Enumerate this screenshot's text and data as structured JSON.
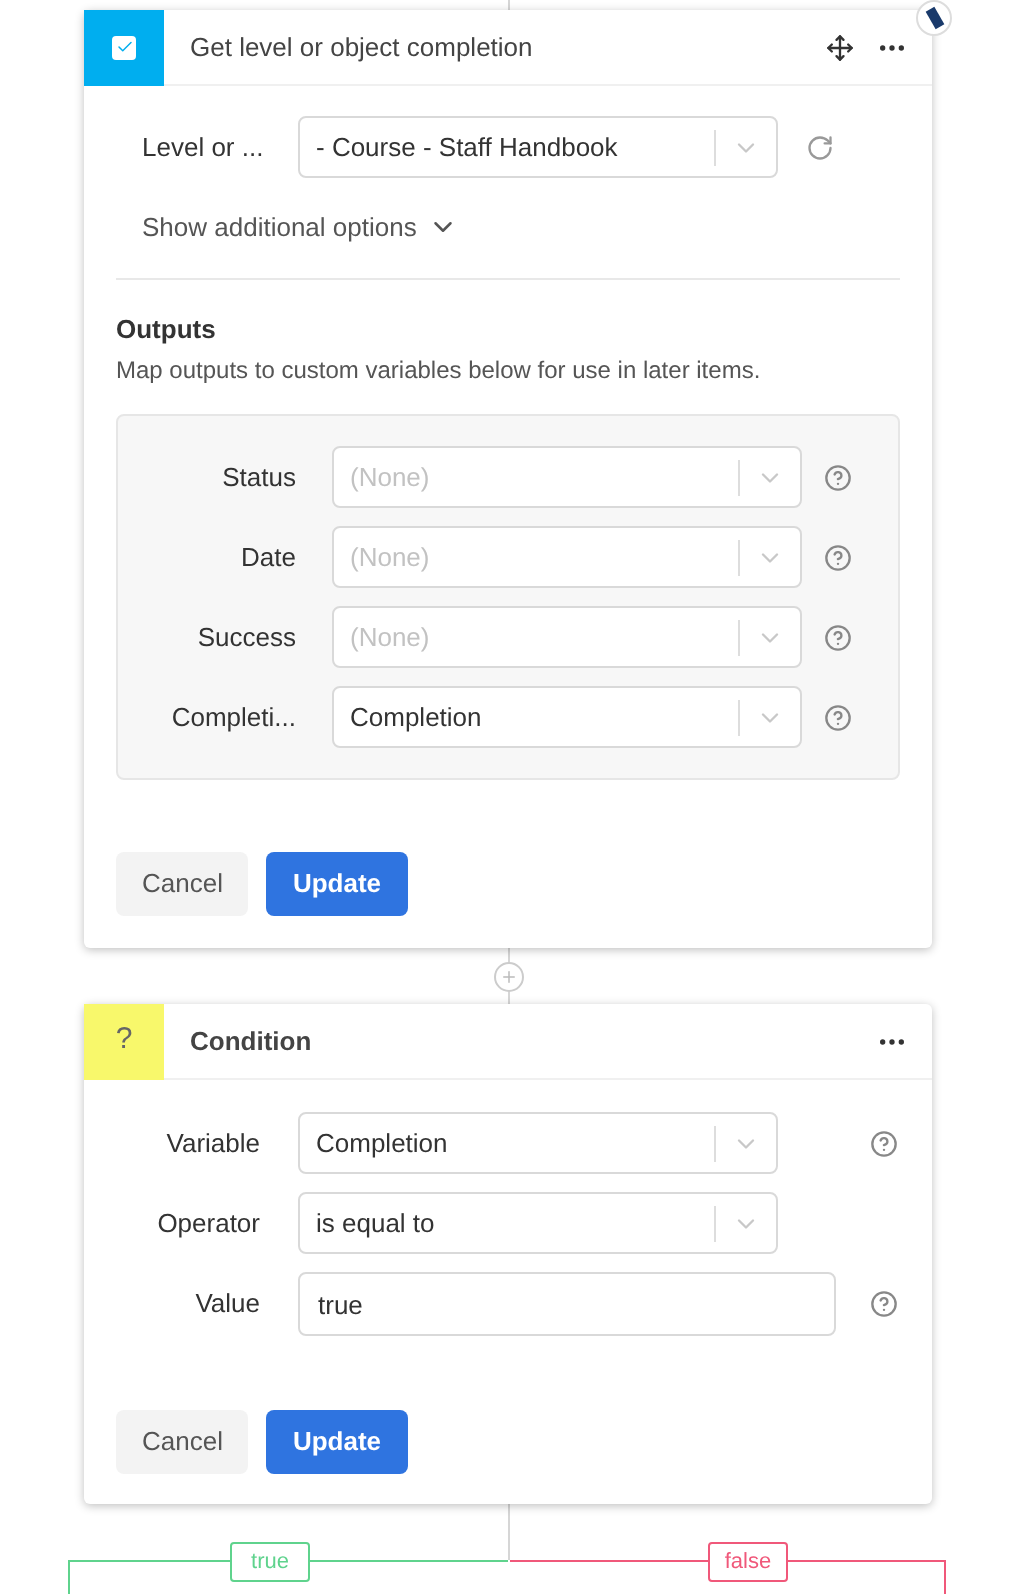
{
  "action_card": {
    "title": "Get level or object completion",
    "source": {
      "label": "Level or ...",
      "value": "- Course - Staff Handbook"
    },
    "additional_options": {
      "label": "Show additional options",
      "expanded": false
    },
    "outputs_title": "Outputs",
    "outputs_description": "Map outputs to custom variables below for use in later items.",
    "outputs": [
      {
        "label": "Status",
        "placeholder": "(None)"
      },
      {
        "label": "Date",
        "placeholder": "(None)"
      },
      {
        "label": "Success",
        "placeholder": "(None)"
      },
      {
        "label": "Completi...",
        "value": "Completion"
      }
    ],
    "buttons": {
      "cancel": "Cancel",
      "update": "Update"
    }
  },
  "condition_card": {
    "icon": "?",
    "title": "Condition",
    "fields": [
      {
        "kind": "select",
        "label": "Variable",
        "value": "Completion",
        "help": true
      },
      {
        "kind": "select",
        "label": "Operator",
        "value": "is equal to",
        "help": false
      },
      {
        "kind": "text",
        "label": "Value",
        "value": "true",
        "help": true
      }
    ],
    "buttons": {
      "cancel": "Cancel",
      "update": "Update"
    }
  },
  "branches": [
    {
      "label": "true",
      "color": "#5fd38d"
    },
    {
      "label": "false",
      "color": "#f0587a"
    }
  ]
}
